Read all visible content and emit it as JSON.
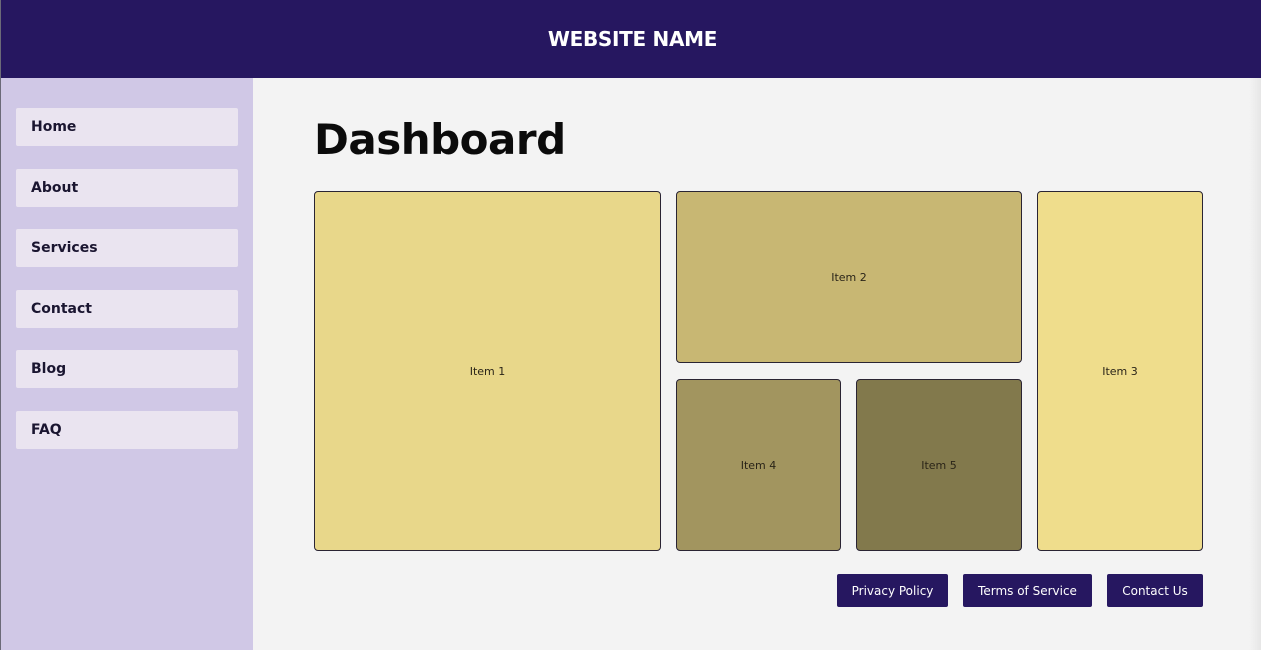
{
  "header": {
    "title": "WEBSITE NAME"
  },
  "sidebar": {
    "items": [
      {
        "label": "Home"
      },
      {
        "label": "About"
      },
      {
        "label": "Services"
      },
      {
        "label": "Contact"
      },
      {
        "label": "Blog"
      },
      {
        "label": "FAQ"
      }
    ]
  },
  "main": {
    "title": "Dashboard",
    "items": [
      {
        "label": "Item 1",
        "color": "#e8d78a"
      },
      {
        "label": "Item 2",
        "color": "#c8b773"
      },
      {
        "label": "Item 3",
        "color": "#efdd8c"
      },
      {
        "label": "Item 4",
        "color": "#a2955f"
      },
      {
        "label": "Item 5",
        "color": "#82794c"
      }
    ]
  },
  "footer": {
    "links": [
      {
        "label": "Privacy Policy"
      },
      {
        "label": "Terms of Service"
      },
      {
        "label": "Contact Us"
      }
    ]
  },
  "colors": {
    "brand": "#261760",
    "sidebar_bg": "#d0c8e6",
    "nav_item_bg": "#eae4f0",
    "content_bg": "#f3f3f3"
  }
}
